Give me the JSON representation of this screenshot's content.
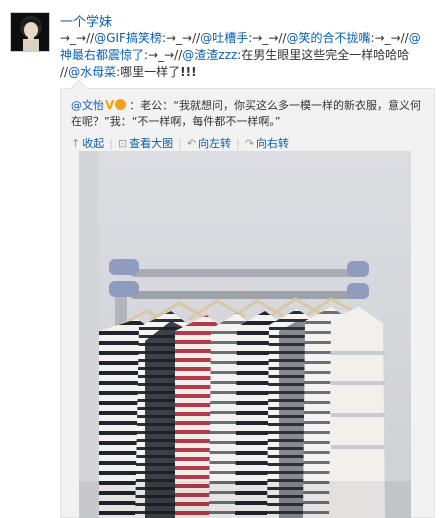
{
  "user": {
    "name": "一个学妹"
  },
  "post": {
    "prefix1": "→_→//",
    "mention1": "@GIF搞笑榜",
    "prefix2": ":→_→//",
    "mention2": "@吐槽手",
    "prefix3": ":→_→//",
    "mention3": "@笑的合不拢嘴",
    "prefix4": ":→_→//",
    "mention4": "@神最右都震惊了",
    "prefix5": ":→_→//",
    "mention5": "@渣渣zzz",
    "text5": ":在男生眼里这些完全一样哈哈哈 //",
    "mention6": "@水母菜",
    "text6": ":哪里一样了",
    "exclaim": "!!!"
  },
  "original": {
    "author": "@文怡",
    "text": "：老公：“我就想问，你买这么多一模一样的新衣服，意义何在呢？”我：“不一样啊，每件都不一样啊。”"
  },
  "actions": {
    "collapse": "收起",
    "view_large": "查看大图",
    "rotate_left": "向左转",
    "rotate_right": "向右转"
  }
}
